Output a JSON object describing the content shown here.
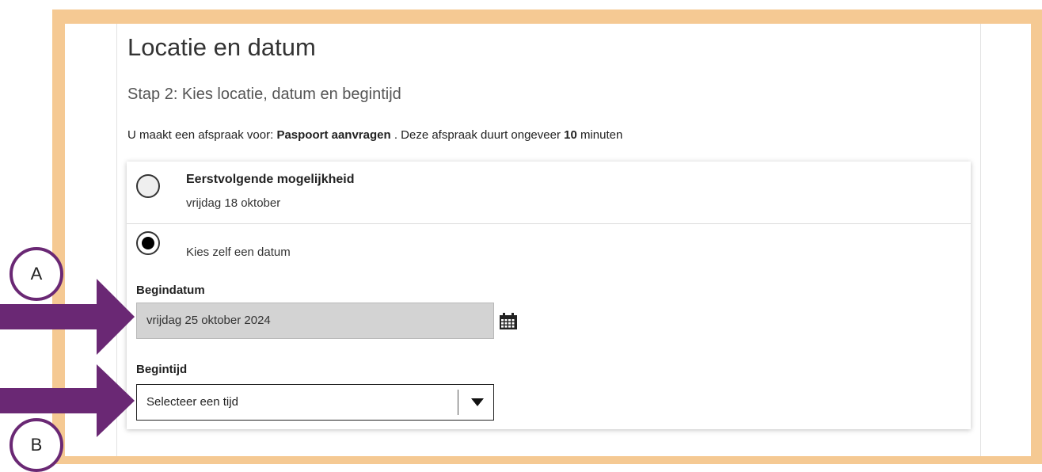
{
  "page": {
    "title": "Locatie en datum",
    "step": "Stap 2: Kies locatie, datum en begintijd",
    "intro": {
      "prefix": "U maakt een afspraak voor: ",
      "service": "Paspoort aanvragen",
      "middle": " . Deze afspraak duurt ongeveer ",
      "duration": "10",
      "suffix": " minuten"
    }
  },
  "options": {
    "first": {
      "title": "Eerstvolgende mogelijkheid",
      "date": "vrijdag 18 oktober",
      "selected": false
    },
    "custom": {
      "label": "Kies zelf een datum",
      "selected": true
    }
  },
  "fields": {
    "begindatum": {
      "label": "Begindatum",
      "value": "vrijdag 25 oktober 2024"
    },
    "begintijd": {
      "label": "Begintijd",
      "value": "Selecteer een tijd"
    }
  },
  "annotations": {
    "a": {
      "label": "A",
      "arrow_color": "#6a2874"
    },
    "b": {
      "label": "B",
      "arrow_color": "#6a2874"
    }
  },
  "colors": {
    "frame": "#f5c993",
    "accent": "#6a2874"
  }
}
